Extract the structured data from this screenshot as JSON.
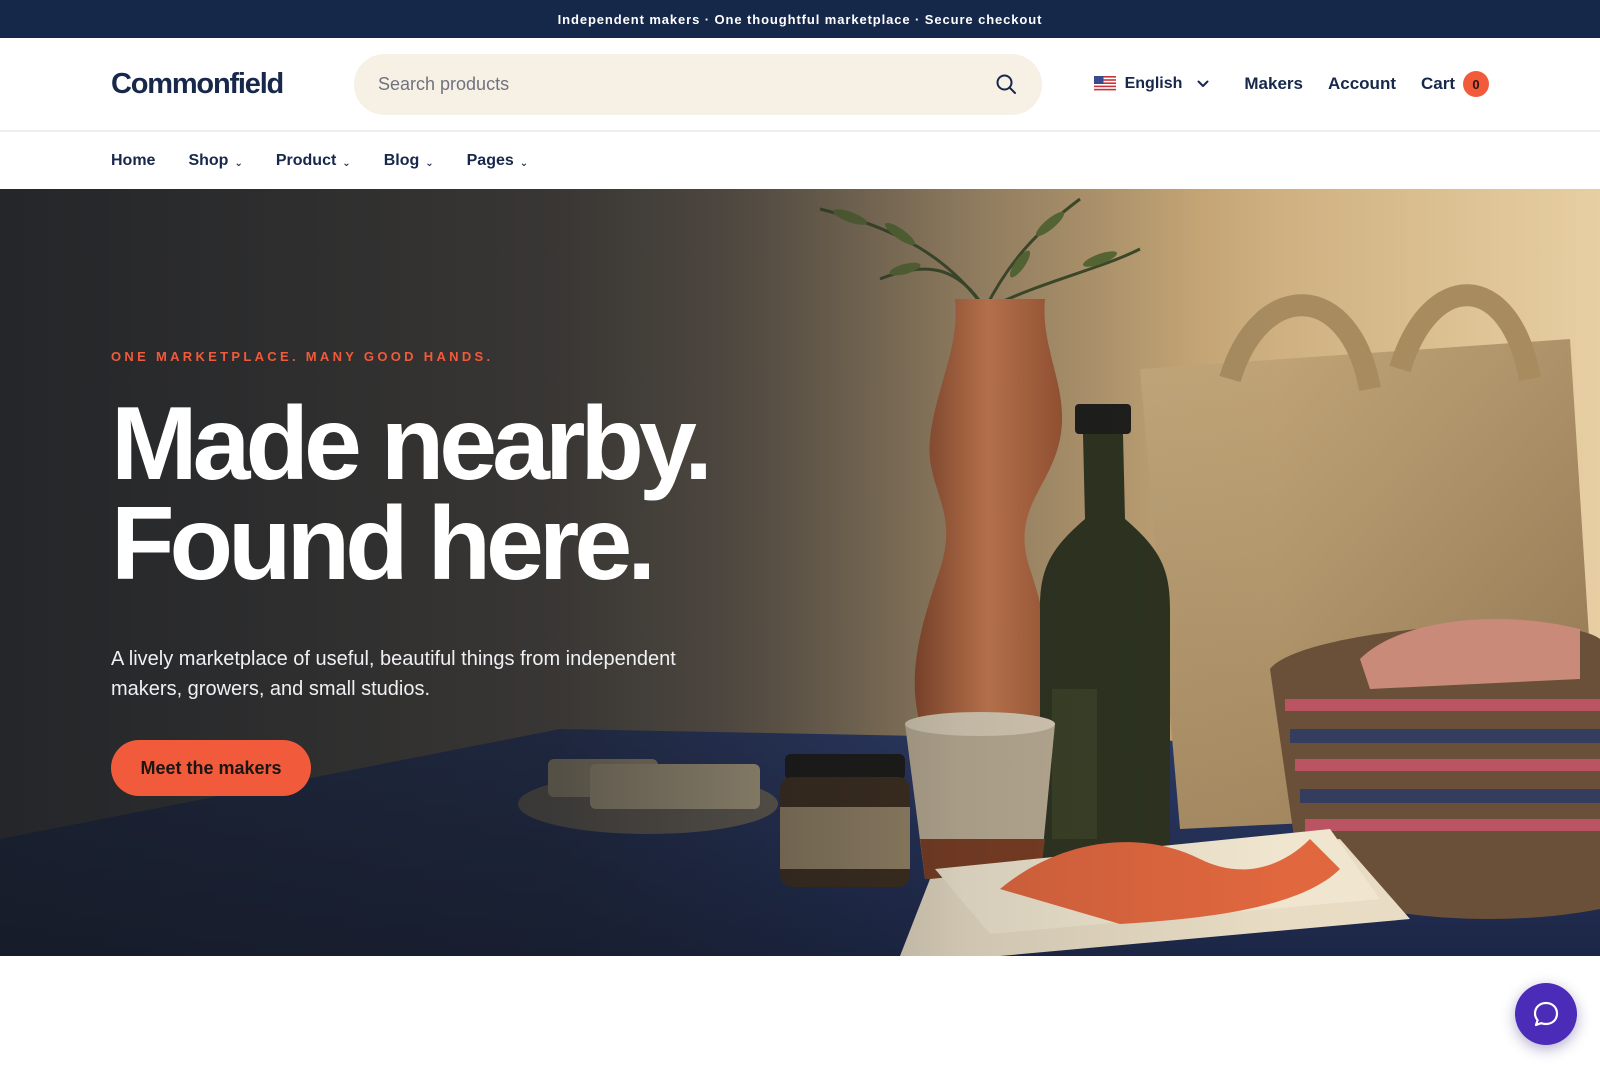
{
  "announcement": {
    "text": "Independent makers · One thoughtful marketplace · Secure checkout"
  },
  "header": {
    "logo": "Commonfield",
    "search": {
      "placeholder": "Search products",
      "value": ""
    },
    "language": {
      "label": "English",
      "icon": "us-flag-icon"
    },
    "links": {
      "makers": "Makers",
      "account": "Account"
    },
    "cart": {
      "label": "Cart",
      "count": "0"
    }
  },
  "nav": {
    "items": [
      {
        "label": "Home",
        "has_dropdown": false
      },
      {
        "label": "Shop",
        "has_dropdown": true
      },
      {
        "label": "Product",
        "has_dropdown": true
      },
      {
        "label": "Blog",
        "has_dropdown": true
      },
      {
        "label": "Pages",
        "has_dropdown": true
      }
    ],
    "chevron": "⌄"
  },
  "hero": {
    "eyebrow": "ONE MARKETPLACE. MANY GOOD HANDS.",
    "headline_line1": "Made nearby.",
    "headline_line2": "Found here.",
    "subtext": "A lively marketplace of useful, beautiful things from independent makers, growers, and small studios.",
    "cta_label": "Meet the makers"
  },
  "chat": {
    "icon": "chat-bubble-icon"
  },
  "colors": {
    "navy": "#16284a",
    "accent": "#f15a3b",
    "search_bg": "#f7f0e4",
    "chat": "#4a2cb8"
  }
}
